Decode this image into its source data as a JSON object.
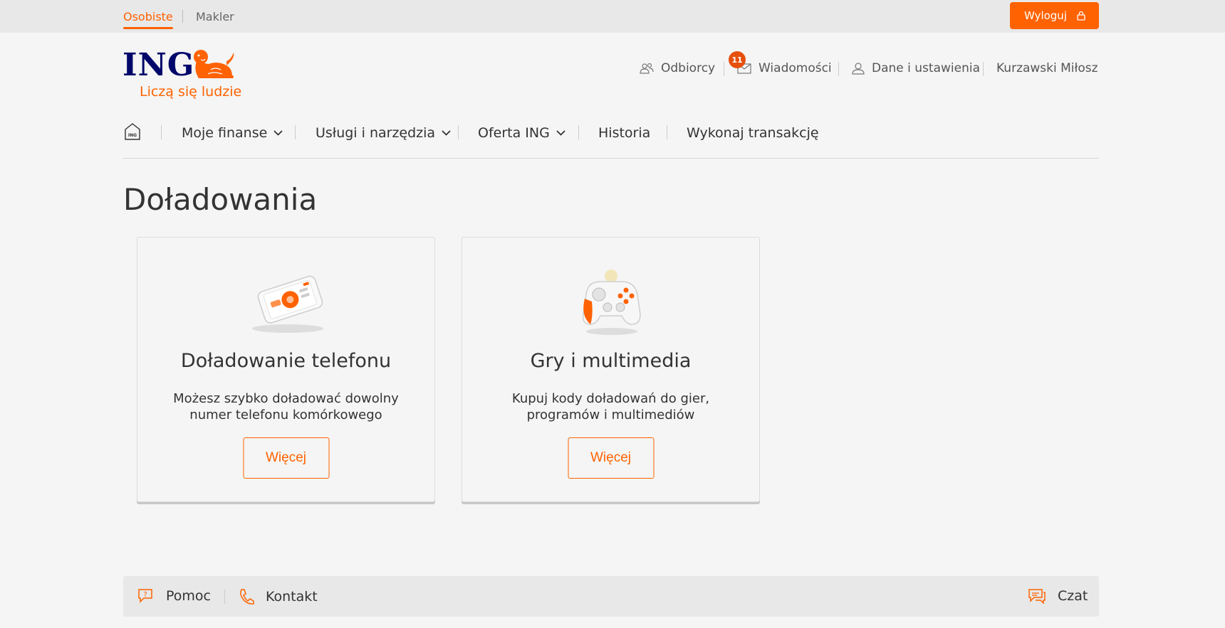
{
  "topbar": {
    "tabs": [
      {
        "label": "Osobiste",
        "active": true
      },
      {
        "label": "Makler",
        "active": false
      }
    ],
    "logout_label": "Wyloguj"
  },
  "logo": {
    "brand": "ING",
    "tagline": "Liczą się ludzie"
  },
  "utility_nav": {
    "recipients": "Odbiorcy",
    "messages": "Wiadomości",
    "messages_badge": "11",
    "settings": "Dane i ustawienia",
    "user": "Kurzawski Miłosz"
  },
  "main_nav": {
    "home_icon_text": "ING",
    "items": [
      {
        "label": "Moje finanse"
      },
      {
        "label": "Usługi i narzędzia"
      },
      {
        "label": "Oferta ING"
      },
      {
        "label": "Historia"
      },
      {
        "label": "Wykonaj transakcję"
      }
    ]
  },
  "page": {
    "title": "Doładowania"
  },
  "cards": [
    {
      "title": "Doładowanie telefonu",
      "description": "Możesz szybko doładować dowolny numer telefonu komórkowego",
      "button": "Więcej",
      "icon": "smartphone-icon"
    },
    {
      "title": "Gry i multimedia",
      "description": "Kupuj kody doładowań do gier, programów i multimediów",
      "button": "Więcej",
      "icon": "gamepad-icon"
    }
  ],
  "footer": {
    "help": "Pomoc",
    "contact": "Kontakt",
    "chat": "Czat"
  },
  "colors": {
    "accent": "#ff6200",
    "brand_navy": "#00076a",
    "background": "#f4f5f4"
  }
}
